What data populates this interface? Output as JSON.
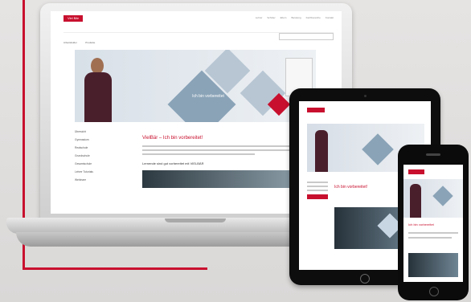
{
  "laptop": {
    "logo": "Viel Bär",
    "nav": [
      "Lehrer",
      "Schüler",
      "Eltern",
      "Beratung",
      "Fachbereiche",
      "Kontakt"
    ],
    "subnav": [
      "Arbeitsfelder",
      "Produkte"
    ],
    "hero_caption": "Ich bin vorbereitet",
    "sidebar": [
      "Übersicht",
      "Gymnasium",
      "Realschule",
      "Grundschule",
      "Gesamtschule",
      "Lehrer Tutorials",
      "Webinare"
    ],
    "article_title": "VielBär – Ich bin vorbereitet!",
    "section_heading": "Lernende sind gut vorbereitet mit VIELBÄR"
  },
  "tablet": {
    "title": "Ich bin vorbereitet!"
  },
  "phone": {
    "title": "Ich bin vorbereitet"
  },
  "colors": {
    "brand_red": "#c8102e",
    "hero_blue": "#dce3ea",
    "device_black": "#0d0d0d"
  }
}
